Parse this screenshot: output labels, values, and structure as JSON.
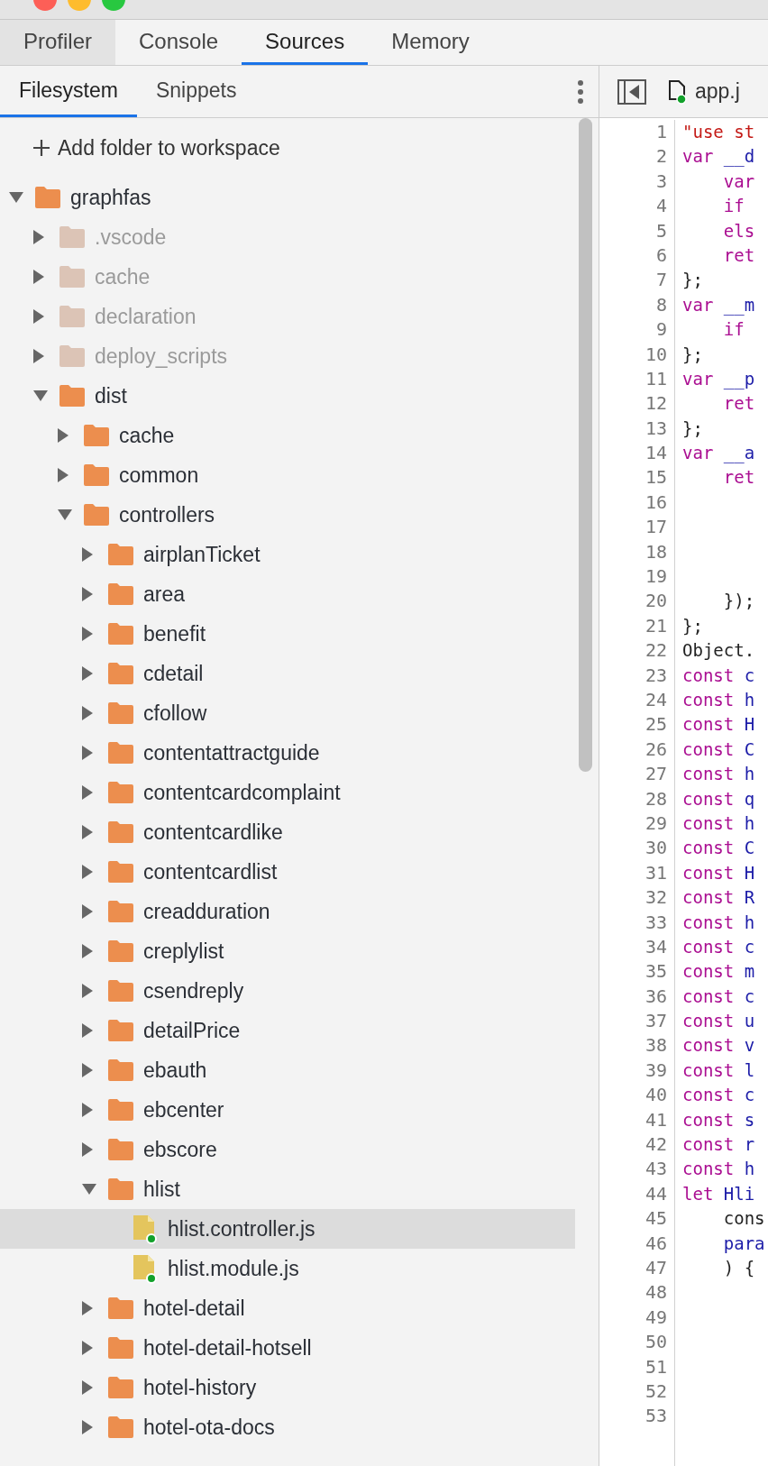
{
  "tabs": [
    {
      "label": "Profiler",
      "selected": false,
      "hovered": true
    },
    {
      "label": "Console",
      "selected": false,
      "hovered": false
    },
    {
      "label": "Sources",
      "selected": true,
      "hovered": false
    },
    {
      "label": "Memory",
      "selected": false,
      "hovered": false
    }
  ],
  "navigator": {
    "tabs": [
      {
        "label": "Filesystem",
        "selected": true
      },
      {
        "label": "Snippets",
        "selected": false
      }
    ],
    "add_folder": "Add folder to workspace",
    "tree": [
      {
        "name": "graphfas",
        "kind": "folder",
        "expanded": true,
        "dimmed": false,
        "selected": false,
        "children": [
          {
            "name": ".vscode",
            "kind": "folder",
            "expanded": false,
            "dimmed": true,
            "selected": false
          },
          {
            "name": "cache",
            "kind": "folder",
            "expanded": false,
            "dimmed": true,
            "selected": false
          },
          {
            "name": "declaration",
            "kind": "folder",
            "expanded": false,
            "dimmed": true,
            "selected": false
          },
          {
            "name": "deploy_scripts",
            "kind": "folder",
            "expanded": false,
            "dimmed": true,
            "selected": false
          },
          {
            "name": "dist",
            "kind": "folder",
            "expanded": true,
            "dimmed": false,
            "selected": false,
            "children": [
              {
                "name": "cache",
                "kind": "folder",
                "expanded": false,
                "dimmed": false,
                "selected": false
              },
              {
                "name": "common",
                "kind": "folder",
                "expanded": false,
                "dimmed": false,
                "selected": false
              },
              {
                "name": "controllers",
                "kind": "folder",
                "expanded": true,
                "dimmed": false,
                "selected": false,
                "children": [
                  {
                    "name": "airplanTicket",
                    "kind": "folder",
                    "expanded": false,
                    "dimmed": false,
                    "selected": false
                  },
                  {
                    "name": "area",
                    "kind": "folder",
                    "expanded": false,
                    "dimmed": false,
                    "selected": false
                  },
                  {
                    "name": "benefit",
                    "kind": "folder",
                    "expanded": false,
                    "dimmed": false,
                    "selected": false
                  },
                  {
                    "name": "cdetail",
                    "kind": "folder",
                    "expanded": false,
                    "dimmed": false,
                    "selected": false
                  },
                  {
                    "name": "cfollow",
                    "kind": "folder",
                    "expanded": false,
                    "dimmed": false,
                    "selected": false
                  },
                  {
                    "name": "contentattractguide",
                    "kind": "folder",
                    "expanded": false,
                    "dimmed": false,
                    "selected": false
                  },
                  {
                    "name": "contentcardcomplaint",
                    "kind": "folder",
                    "expanded": false,
                    "dimmed": false,
                    "selected": false
                  },
                  {
                    "name": "contentcardlike",
                    "kind": "folder",
                    "expanded": false,
                    "dimmed": false,
                    "selected": false
                  },
                  {
                    "name": "contentcardlist",
                    "kind": "folder",
                    "expanded": false,
                    "dimmed": false,
                    "selected": false
                  },
                  {
                    "name": "creadduration",
                    "kind": "folder",
                    "expanded": false,
                    "dimmed": false,
                    "selected": false
                  },
                  {
                    "name": "creplylist",
                    "kind": "folder",
                    "expanded": false,
                    "dimmed": false,
                    "selected": false
                  },
                  {
                    "name": "csendreply",
                    "kind": "folder",
                    "expanded": false,
                    "dimmed": false,
                    "selected": false
                  },
                  {
                    "name": "detailPrice",
                    "kind": "folder",
                    "expanded": false,
                    "dimmed": false,
                    "selected": false
                  },
                  {
                    "name": "ebauth",
                    "kind": "folder",
                    "expanded": false,
                    "dimmed": false,
                    "selected": false
                  },
                  {
                    "name": "ebcenter",
                    "kind": "folder",
                    "expanded": false,
                    "dimmed": false,
                    "selected": false
                  },
                  {
                    "name": "ebscore",
                    "kind": "folder",
                    "expanded": false,
                    "dimmed": false,
                    "selected": false
                  },
                  {
                    "name": "hlist",
                    "kind": "folder",
                    "expanded": true,
                    "dimmed": false,
                    "selected": false,
                    "children": [
                      {
                        "name": "hlist.controller.js",
                        "kind": "file",
                        "dimmed": false,
                        "selected": true
                      },
                      {
                        "name": "hlist.module.js",
                        "kind": "file",
                        "dimmed": false,
                        "selected": false
                      }
                    ]
                  },
                  {
                    "name": "hotel-detail",
                    "kind": "folder",
                    "expanded": false,
                    "dimmed": false,
                    "selected": false
                  },
                  {
                    "name": "hotel-detail-hotsell",
                    "kind": "folder",
                    "expanded": false,
                    "dimmed": false,
                    "selected": false
                  },
                  {
                    "name": "hotel-history",
                    "kind": "folder",
                    "expanded": false,
                    "dimmed": false,
                    "selected": false
                  },
                  {
                    "name": "hotel-ota-docs",
                    "kind": "folder",
                    "expanded": false,
                    "dimmed": false,
                    "selected": false
                  }
                ]
              }
            ]
          }
        ]
      }
    ]
  },
  "editor": {
    "tab": "app.j",
    "lines": [
      {
        "number": "1",
        "tokens": [
          {
            "kind": "string",
            "text": "\"use st"
          }
        ]
      },
      {
        "number": "2",
        "tokens": [
          {
            "kind": "keyword",
            "text": "var "
          },
          {
            "kind": "name",
            "text": "__d"
          }
        ]
      },
      {
        "number": "3",
        "tokens": [
          {
            "kind": "keyword",
            "text": "    var"
          }
        ]
      },
      {
        "number": "4",
        "tokens": [
          {
            "kind": "keyword",
            "text": "    if"
          }
        ]
      },
      {
        "number": "5",
        "tokens": [
          {
            "kind": "keyword",
            "text": "    els"
          }
        ]
      },
      {
        "number": "6",
        "tokens": [
          {
            "kind": "keyword",
            "text": "    ret"
          }
        ]
      },
      {
        "number": "7",
        "tokens": [
          {
            "kind": "plain",
            "text": "};"
          }
        ]
      },
      {
        "number": "8",
        "tokens": [
          {
            "kind": "keyword",
            "text": "var "
          },
          {
            "kind": "name",
            "text": "__m"
          }
        ]
      },
      {
        "number": "9",
        "tokens": [
          {
            "kind": "keyword",
            "text": "    if"
          }
        ]
      },
      {
        "number": "10",
        "tokens": [
          {
            "kind": "plain",
            "text": "};"
          }
        ]
      },
      {
        "number": "11",
        "tokens": [
          {
            "kind": "keyword",
            "text": "var "
          },
          {
            "kind": "name",
            "text": "__p"
          }
        ]
      },
      {
        "number": "12",
        "tokens": [
          {
            "kind": "keyword",
            "text": "    ret"
          }
        ]
      },
      {
        "number": "13",
        "tokens": [
          {
            "kind": "plain",
            "text": "};"
          }
        ]
      },
      {
        "number": "14",
        "tokens": [
          {
            "kind": "keyword",
            "text": "var "
          },
          {
            "kind": "name",
            "text": "__a"
          }
        ]
      },
      {
        "number": "15",
        "tokens": [
          {
            "kind": "keyword",
            "text": "    ret"
          }
        ]
      },
      {
        "number": "16"
      },
      {
        "number": "17"
      },
      {
        "number": "18"
      },
      {
        "number": "19"
      },
      {
        "number": "20",
        "tokens": [
          {
            "kind": "plain",
            "text": "    });"
          }
        ]
      },
      {
        "number": "21",
        "tokens": [
          {
            "kind": "plain",
            "text": "};"
          }
        ]
      },
      {
        "number": "22",
        "tokens": [
          {
            "kind": "plain",
            "text": "Object."
          }
        ]
      },
      {
        "number": "23",
        "tokens": [
          {
            "kind": "keyword",
            "text": "const "
          },
          {
            "kind": "name",
            "text": "c"
          }
        ]
      },
      {
        "number": "24",
        "tokens": [
          {
            "kind": "keyword",
            "text": "const "
          },
          {
            "kind": "name",
            "text": "h"
          }
        ]
      },
      {
        "number": "25",
        "tokens": [
          {
            "kind": "keyword",
            "text": "const "
          },
          {
            "kind": "name",
            "text": "H"
          }
        ]
      },
      {
        "number": "26",
        "tokens": [
          {
            "kind": "keyword",
            "text": "const "
          },
          {
            "kind": "name",
            "text": "C"
          }
        ]
      },
      {
        "number": "27",
        "tokens": [
          {
            "kind": "keyword",
            "text": "const "
          },
          {
            "kind": "name",
            "text": "h"
          }
        ]
      },
      {
        "number": "28",
        "tokens": [
          {
            "kind": "keyword",
            "text": "const "
          },
          {
            "kind": "name",
            "text": "q"
          }
        ]
      },
      {
        "number": "29",
        "tokens": [
          {
            "kind": "keyword",
            "text": "const "
          },
          {
            "kind": "name",
            "text": "h"
          }
        ]
      },
      {
        "number": "30",
        "tokens": [
          {
            "kind": "keyword",
            "text": "const "
          },
          {
            "kind": "name",
            "text": "C"
          }
        ]
      },
      {
        "number": "31",
        "tokens": [
          {
            "kind": "keyword",
            "text": "const "
          },
          {
            "kind": "name",
            "text": "H"
          }
        ]
      },
      {
        "number": "32",
        "tokens": [
          {
            "kind": "keyword",
            "text": "const "
          },
          {
            "kind": "name",
            "text": "R"
          }
        ]
      },
      {
        "number": "33",
        "tokens": [
          {
            "kind": "keyword",
            "text": "const "
          },
          {
            "kind": "name",
            "text": "h"
          }
        ]
      },
      {
        "number": "34",
        "tokens": [
          {
            "kind": "keyword",
            "text": "const "
          },
          {
            "kind": "name",
            "text": "c"
          }
        ]
      },
      {
        "number": "35",
        "tokens": [
          {
            "kind": "keyword",
            "text": "const "
          },
          {
            "kind": "name",
            "text": "m"
          }
        ]
      },
      {
        "number": "36",
        "tokens": [
          {
            "kind": "keyword",
            "text": "const "
          },
          {
            "kind": "name",
            "text": "c"
          }
        ]
      },
      {
        "number": "37",
        "tokens": [
          {
            "kind": "keyword",
            "text": "const "
          },
          {
            "kind": "name",
            "text": "u"
          }
        ]
      },
      {
        "number": "38",
        "tokens": [
          {
            "kind": "keyword",
            "text": "const "
          },
          {
            "kind": "name",
            "text": "v"
          }
        ]
      },
      {
        "number": "39",
        "tokens": [
          {
            "kind": "keyword",
            "text": "const "
          },
          {
            "kind": "name",
            "text": "l"
          }
        ]
      },
      {
        "number": "40",
        "tokens": [
          {
            "kind": "keyword",
            "text": "const "
          },
          {
            "kind": "name",
            "text": "c"
          }
        ]
      },
      {
        "number": "41",
        "tokens": [
          {
            "kind": "keyword",
            "text": "const "
          },
          {
            "kind": "name",
            "text": "s"
          }
        ]
      },
      {
        "number": "42",
        "tokens": [
          {
            "kind": "keyword",
            "text": "const "
          },
          {
            "kind": "name",
            "text": "r"
          }
        ]
      },
      {
        "number": "43",
        "tokens": [
          {
            "kind": "keyword",
            "text": "const "
          },
          {
            "kind": "name",
            "text": "h"
          }
        ]
      },
      {
        "number": "44",
        "tokens": [
          {
            "kind": "keyword",
            "text": "let "
          },
          {
            "kind": "name",
            "text": "Hli"
          }
        ]
      },
      {
        "number": "45",
        "tokens": [
          {
            "kind": "plain",
            "text": "    cons"
          }
        ]
      },
      {
        "number": "46",
        "tokens": [
          {
            "kind": "name",
            "text": "    para"
          }
        ]
      },
      {
        "number": "47",
        "tokens": [
          {
            "kind": "plain",
            "text": "    ) {"
          }
        ]
      },
      {
        "number": "48"
      },
      {
        "number": "49"
      },
      {
        "number": "50"
      },
      {
        "number": "51"
      },
      {
        "number": "52"
      },
      {
        "number": "53"
      }
    ]
  }
}
